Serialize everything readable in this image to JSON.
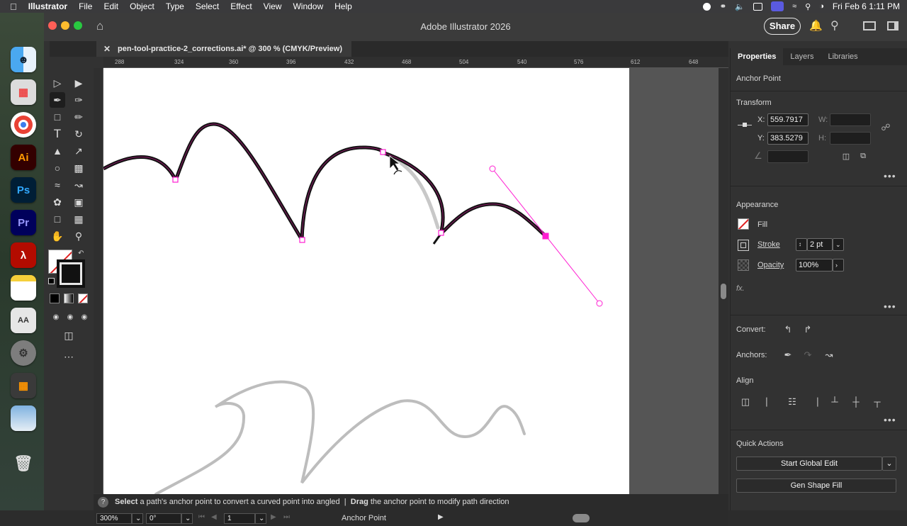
{
  "menubar": {
    "app": "Illustrator",
    "items": [
      "File",
      "Edit",
      "Object",
      "Type",
      "Select",
      "Effect",
      "View",
      "Window",
      "Help"
    ],
    "datetime": "Fri Feb 6  1:11 PM"
  },
  "window": {
    "title": "Adobe Illustrator 2026",
    "share_label": "Share"
  },
  "document_tab": {
    "title": "pen-tool-practice-2_corrections.ai* @ 300 % (CMYK/Preview)",
    "close": "✕"
  },
  "ruler": {
    "ticks": [
      "288",
      "324",
      "360",
      "396",
      "432",
      "468",
      "504",
      "540",
      "576",
      "612",
      "648"
    ]
  },
  "status": {
    "hint_bold_1": "Select",
    "hint_1": " a path's anchor point to convert a curved point into angled  |  ",
    "hint_bold_2": "Drag",
    "hint_2": " the anchor point to modify path direction",
    "zoom": "300%",
    "rotation": "0°",
    "artboard": "1",
    "tool_name": "Anchor Point"
  },
  "panel": {
    "tabs": [
      "Properties",
      "Layers",
      "Libraries"
    ],
    "selection_type": "Anchor Point",
    "transform": {
      "heading": "Transform",
      "x_label": "X:",
      "x_value": "559.7917",
      "y_label": "Y:",
      "y_value": "383.5279",
      "w_label": "W:",
      "h_label": "H:"
    },
    "appearance": {
      "heading": "Appearance",
      "fill_label": "Fill",
      "stroke_label": "Stroke",
      "stroke_value": "2 pt",
      "opacity_label": "Opacity",
      "opacity_value": "100%",
      "fx_label": "fx."
    },
    "convert_label": "Convert:",
    "anchors_label": "Anchors:",
    "align_heading": "Align",
    "quick_actions": {
      "heading": "Quick Actions",
      "global_edit": "Start Global Edit",
      "gen_shape": "Gen Shape Fill"
    }
  },
  "colors": {
    "anchor_magenta": "#ff1fd2",
    "path_stroke": "#2a0a20",
    "guide_gray": "#bdbdbd",
    "panel_bg": "#323232"
  }
}
